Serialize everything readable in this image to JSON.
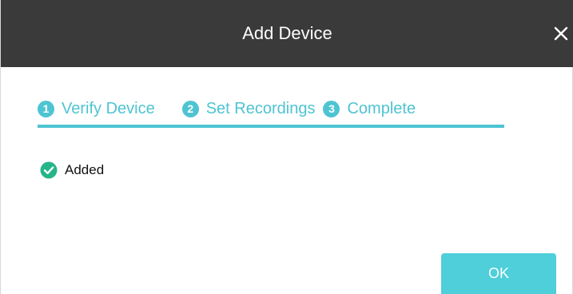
{
  "dialog": {
    "title": "Add Device",
    "close_icon": "close-icon"
  },
  "steps": [
    {
      "number": "1",
      "label": "Verify Device"
    },
    {
      "number": "2",
      "label": "Set Recordings"
    },
    {
      "number": "3",
      "label": "Complete"
    }
  ],
  "status": {
    "icon": "check-circle-icon",
    "text": "Added"
  },
  "footer": {
    "ok_label": "OK"
  },
  "colors": {
    "accent": "#4ec4d2",
    "titlebar": "#3a3a3a",
    "ok_button": "#4ecfda",
    "success": "#26b48a"
  }
}
